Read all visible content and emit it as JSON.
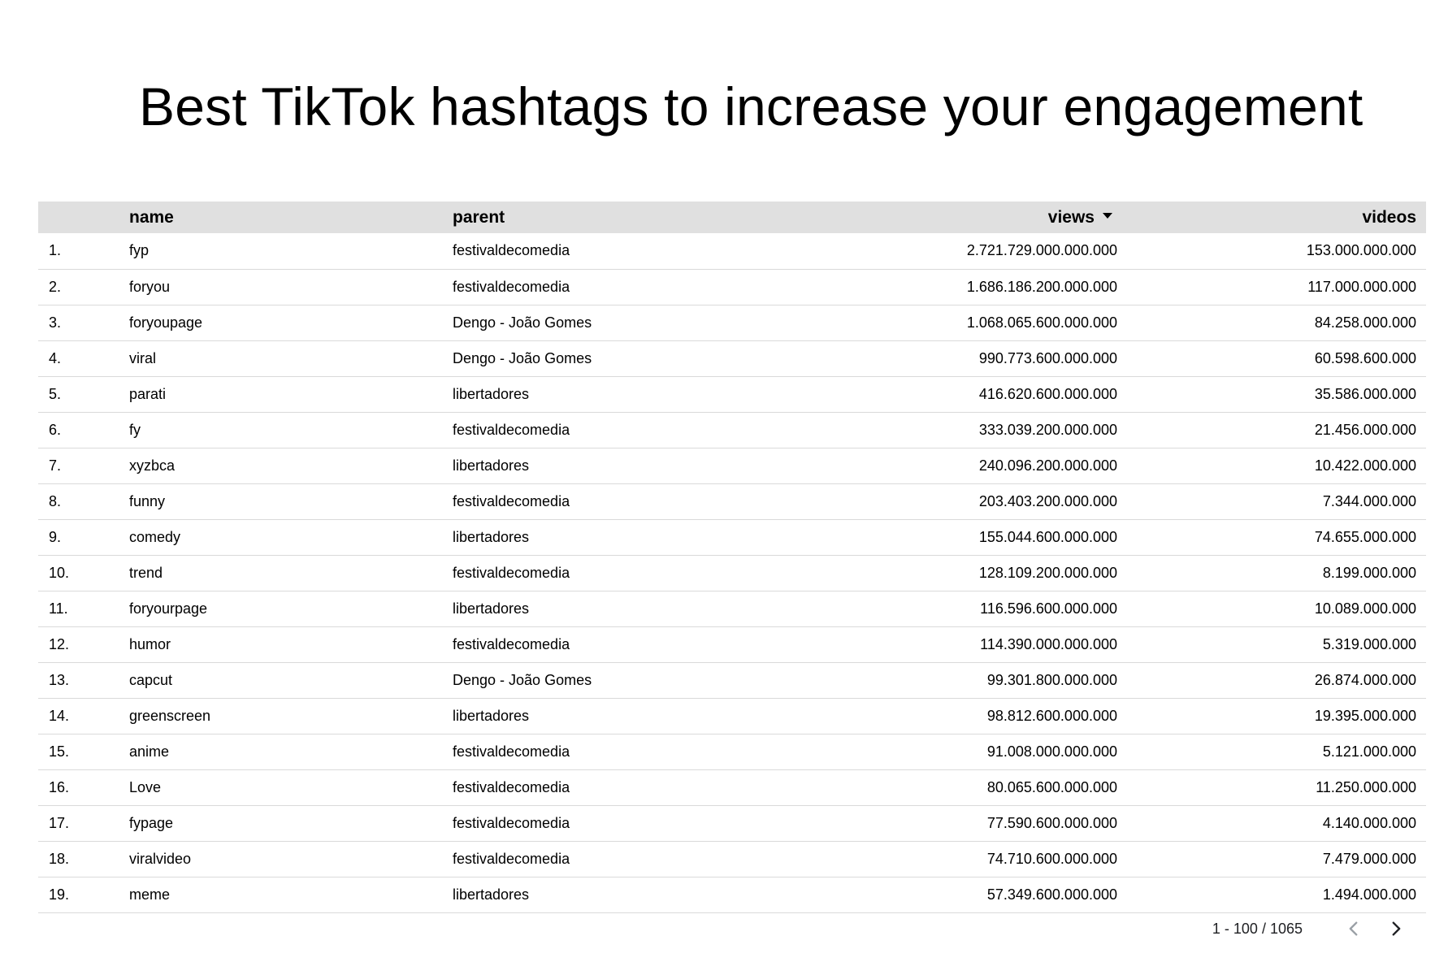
{
  "title": "Best TikTok hashtags to increase your engagement",
  "table": {
    "headers": {
      "index": "",
      "name": "name",
      "parent": "parent",
      "views": "views",
      "videos": "videos"
    },
    "sort": {
      "column": "views",
      "direction": "descending",
      "icon": "sort-desc-icon"
    },
    "rows": [
      {
        "index": "1.",
        "name": "fyp",
        "parent": "festivaldecomedia",
        "views": "2.721.729.000.000.000",
        "videos": "153.000.000.000"
      },
      {
        "index": "2.",
        "name": "foryou",
        "parent": "festivaldecomedia",
        "views": "1.686.186.200.000.000",
        "videos": "117.000.000.000"
      },
      {
        "index": "3.",
        "name": "foryoupage",
        "parent": "Dengo - João Gomes",
        "views": "1.068.065.600.000.000",
        "videos": "84.258.000.000"
      },
      {
        "index": "4.",
        "name": "viral",
        "parent": "Dengo - João Gomes",
        "views": "990.773.600.000.000",
        "videos": "60.598.600.000"
      },
      {
        "index": "5.",
        "name": "parati",
        "parent": "libertadores",
        "views": "416.620.600.000.000",
        "videos": "35.586.000.000"
      },
      {
        "index": "6.",
        "name": "fy",
        "parent": "festivaldecomedia",
        "views": "333.039.200.000.000",
        "videos": "21.456.000.000"
      },
      {
        "index": "7.",
        "name": "xyzbca",
        "parent": "libertadores",
        "views": "240.096.200.000.000",
        "videos": "10.422.000.000"
      },
      {
        "index": "8.",
        "name": "funny",
        "parent": "festivaldecomedia",
        "views": "203.403.200.000.000",
        "videos": "7.344.000.000"
      },
      {
        "index": "9.",
        "name": "comedy",
        "parent": "libertadores",
        "views": "155.044.600.000.000",
        "videos": "74.655.000.000"
      },
      {
        "index": "10.",
        "name": "trend",
        "parent": "festivaldecomedia",
        "views": "128.109.200.000.000",
        "videos": "8.199.000.000"
      },
      {
        "index": "11.",
        "name": "foryourpage",
        "parent": "libertadores",
        "views": "116.596.600.000.000",
        "videos": "10.089.000.000"
      },
      {
        "index": "12.",
        "name": "humor",
        "parent": "festivaldecomedia",
        "views": "114.390.000.000.000",
        "videos": "5.319.000.000"
      },
      {
        "index": "13.",
        "name": "capcut",
        "parent": "Dengo - João Gomes",
        "views": "99.301.800.000.000",
        "videos": "26.874.000.000"
      },
      {
        "index": "14.",
        "name": "greenscreen",
        "parent": "libertadores",
        "views": "98.812.600.000.000",
        "videos": "19.395.000.000"
      },
      {
        "index": "15.",
        "name": "anime",
        "parent": "festivaldecomedia",
        "views": "91.008.000.000.000",
        "videos": "5.121.000.000"
      },
      {
        "index": "16.",
        "name": "Love",
        "parent": "festivaldecomedia",
        "views": "80.065.600.000.000",
        "videos": "11.250.000.000"
      },
      {
        "index": "17.",
        "name": "fypage",
        "parent": "festivaldecomedia",
        "views": "77.590.600.000.000",
        "videos": "4.140.000.000"
      },
      {
        "index": "18.",
        "name": "viralvideo",
        "parent": "festivaldecomedia",
        "views": "74.710.600.000.000",
        "videos": "7.479.000.000"
      },
      {
        "index": "19.",
        "name": "meme",
        "parent": "libertadores",
        "views": "57.349.600.000.000",
        "videos": "1.494.000.000"
      }
    ]
  },
  "pagination": {
    "range": "1 - 100 / 1065",
    "prev_icon": "chevron-left-icon",
    "next_icon": "chevron-right-icon",
    "prev_color": "#9aa0a6",
    "next_color": "#202124"
  }
}
